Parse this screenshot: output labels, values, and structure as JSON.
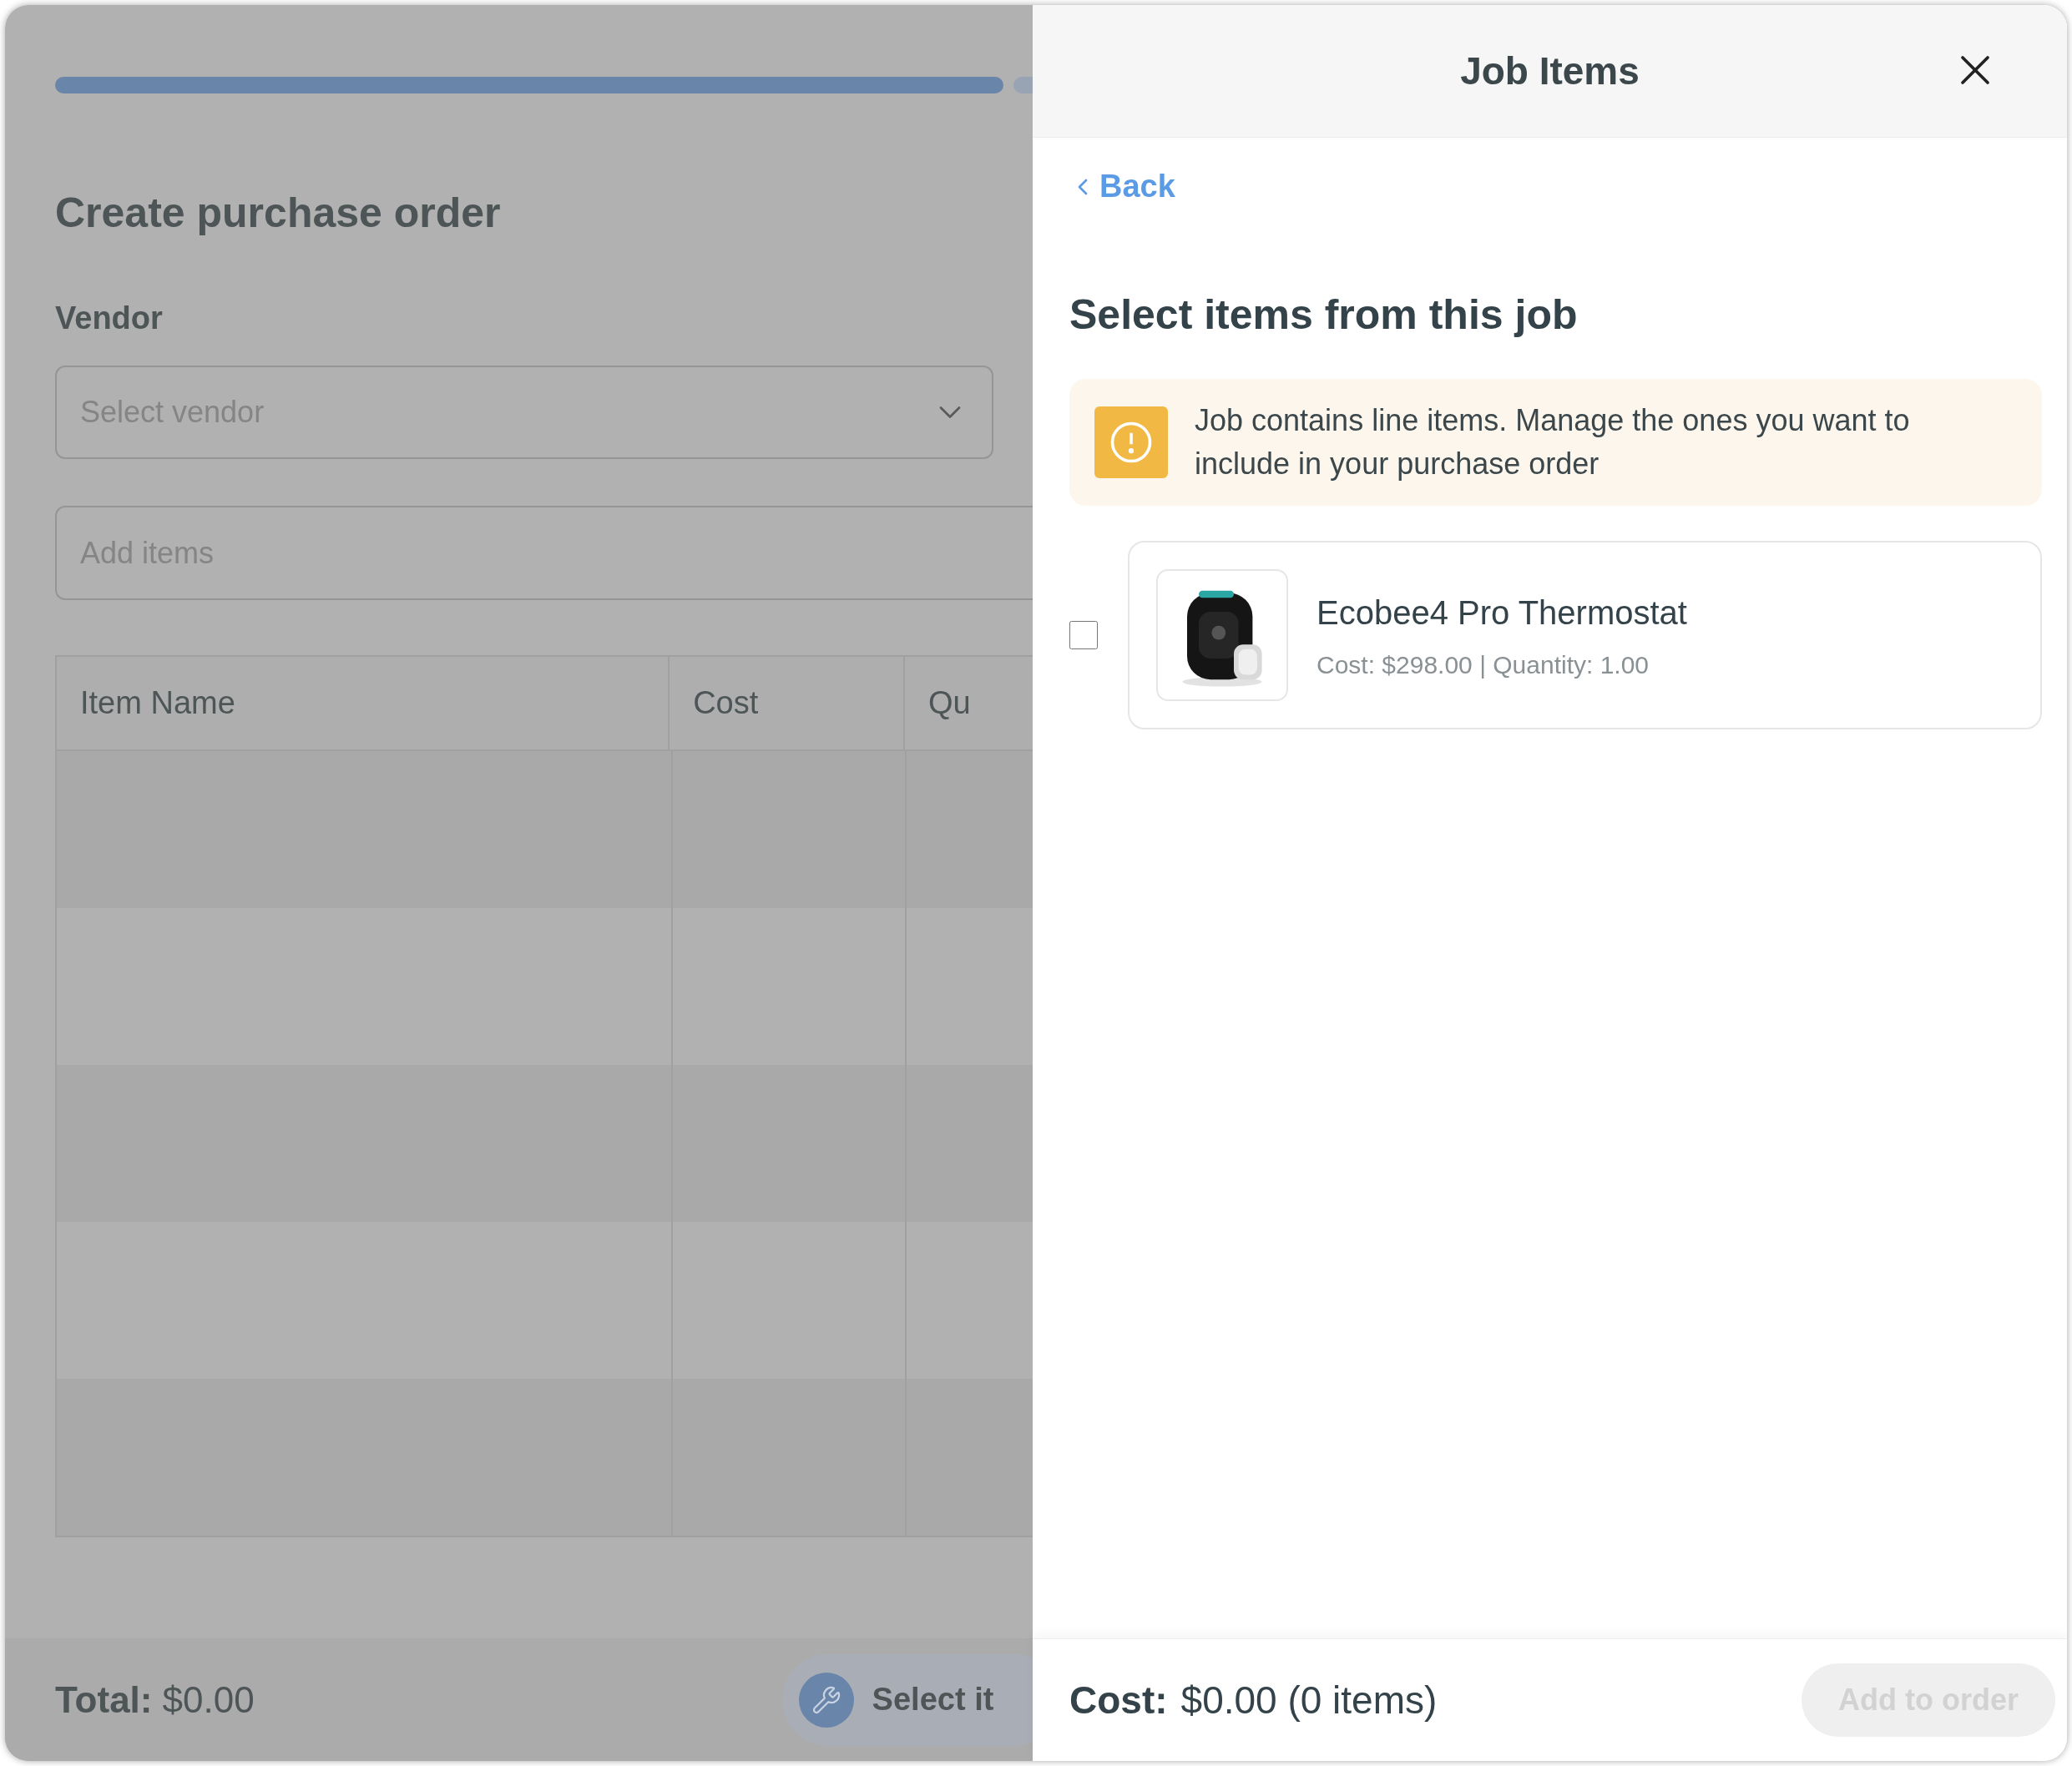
{
  "page": {
    "progress_segments": [
      {
        "done": true
      },
      {
        "done": false
      }
    ],
    "title": "Create purchase order",
    "vendor": {
      "label": "Vendor",
      "placeholder": "Select vendor"
    },
    "add_items": {
      "placeholder": "Add items"
    },
    "table": {
      "columns": [
        "Item Name",
        "Cost",
        "Qu"
      ]
    },
    "footer": {
      "total_label": "Total:",
      "total_value": "$0.00",
      "button": "Select it"
    }
  },
  "panel": {
    "title": "Job Items",
    "back": "Back",
    "heading": "Select items from this job",
    "alert": "Job contains line items. Manage the ones you want to include in your purchase order",
    "items": [
      {
        "name": "Ecobee4 Pro Thermostat",
        "details": "Cost: $298.00 | Quantity: 1.00",
        "checked": false
      }
    ],
    "footer": {
      "cost_label": "Cost:",
      "cost_value": "$0.00 (0 items)",
      "button": {
        "label": "Add to order",
        "disabled": true
      }
    }
  }
}
